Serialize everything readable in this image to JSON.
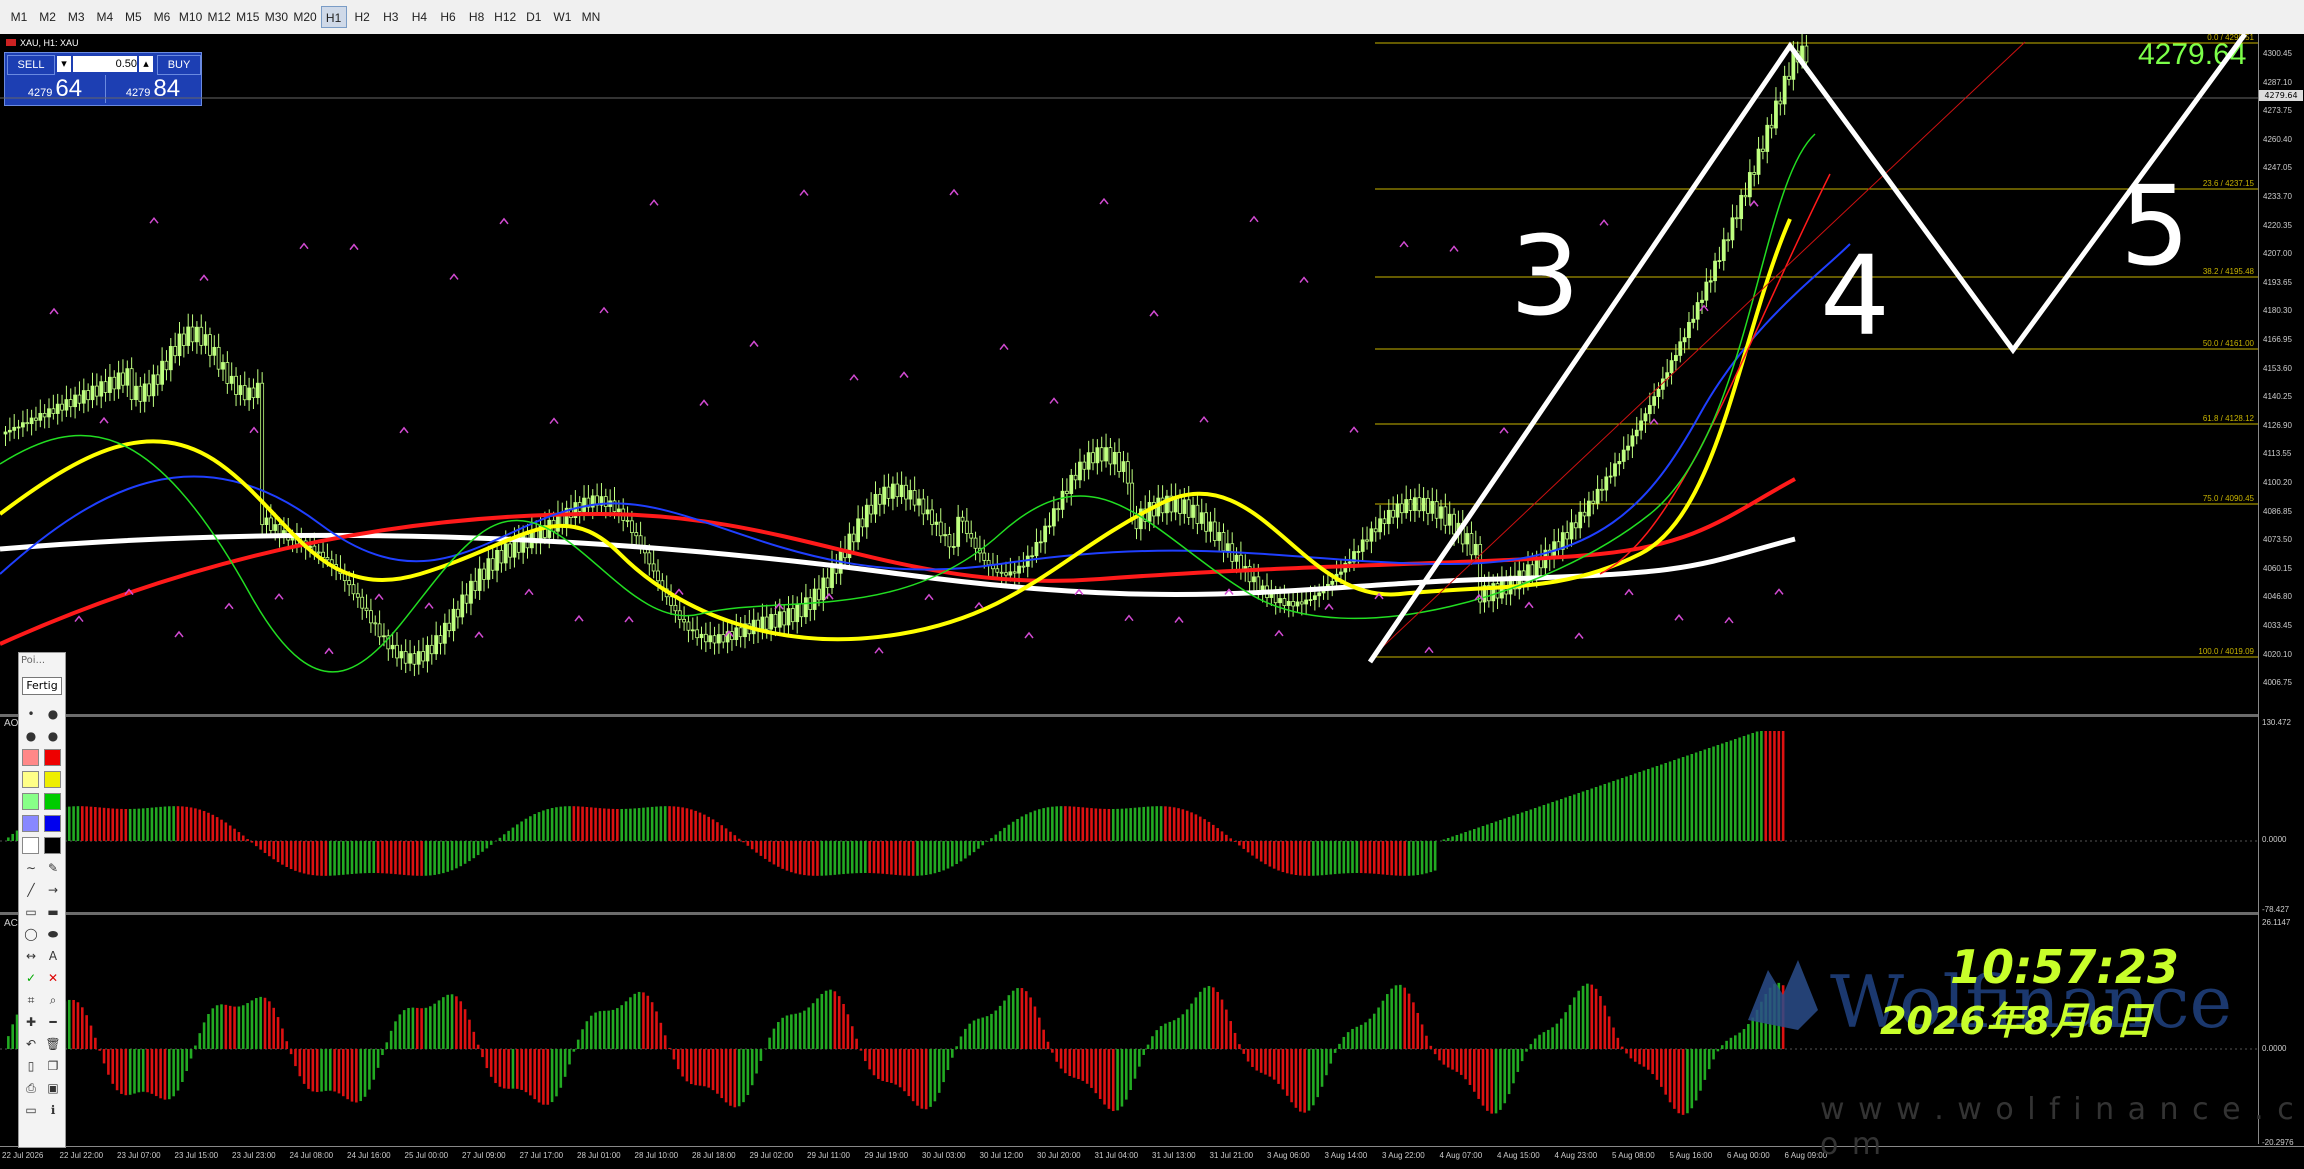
{
  "timeframes": [
    "M1",
    "M2",
    "M3",
    "M4",
    "M5",
    "M6",
    "M10",
    "M12",
    "M15",
    "M30",
    "M20",
    "H1",
    "H2",
    "H3",
    "H4",
    "H6",
    "H8",
    "H12",
    "D1",
    "W1",
    "MN"
  ],
  "active_timeframe": "H1",
  "chart": {
    "title": "XAU, H1: XAU",
    "symbol": "XAU",
    "price_label": "4279.64",
    "current_tag": "4279.64"
  },
  "trade_panel": {
    "sell_label": "SELL",
    "buy_label": "BUY",
    "lot": "0.50",
    "sell_prefix": "4279",
    "sell_big": "64",
    "buy_prefix": "4279",
    "buy_big": "84"
  },
  "price_axis": [
    "4300.45",
    "4287.10",
    "4273.75",
    "4260.40",
    "4247.05",
    "4233.70",
    "4220.35",
    "4207.00",
    "4193.65",
    "4180.30",
    "4166.95",
    "4153.60",
    "4140.25",
    "4126.90",
    "4113.55",
    "4100.20",
    "4086.85",
    "4073.50",
    "4060.15",
    "4046.80",
    "4033.45",
    "4020.10",
    "4006.75"
  ],
  "fib_levels": [
    {
      "label": "0.0  /   4299.51"
    },
    {
      "label": "23.6  /   4237.15"
    },
    {
      "label": "38.2  /   4195.48"
    },
    {
      "label": "50.0  /   4161.00"
    },
    {
      "label": "61.8  /   4128.12"
    },
    {
      "label": "75.0  /   4090.45"
    },
    {
      "label": "100.0  /   4019.09"
    }
  ],
  "wave_labels": [
    "3",
    "4",
    "5"
  ],
  "ao": {
    "label": "AO",
    "max": "130.472",
    "zero": "0.0000",
    "min": "-78.427"
  },
  "ac": {
    "label": "AC",
    "max": "26.1147",
    "zero": "0.0000",
    "min": "-20.2976"
  },
  "time_axis": [
    "22 Jul 2026",
    "22 Jul 22:00",
    "23 Jul 07:00",
    "23 Jul 15:00",
    "23 Jul 23:00",
    "24 Jul 08:00",
    "24 Jul 16:00",
    "25 Jul 00:00",
    "27 Jul 09:00",
    "27 Jul 17:00",
    "28 Jul 01:00",
    "28 Jul 10:00",
    "28 Jul 18:00",
    "29 Jul 02:00",
    "29 Jul 11:00",
    "29 Jul 19:00",
    "30 Jul 03:00",
    "30 Jul 12:00",
    "30 Jul 20:00",
    "31 Jul 04:00",
    "31 Jul 13:00",
    "31 Jul 21:00",
    "3 Aug 06:00",
    "3 Aug 14:00",
    "3 Aug 22:00",
    "4 Aug 07:00",
    "4 Aug 15:00",
    "4 Aug 23:00",
    "5 Aug 08:00",
    "5 Aug 16:00",
    "6 Aug 00:00",
    "6 Aug 09:00"
  ],
  "overlay": {
    "clock": "10:57:23",
    "date": "2026年8月6日",
    "watermark": "Wolfinance",
    "website": "w w w . w o l f i n a n c e . c o m"
  },
  "tool_panel": {
    "title": "Poi...",
    "done_label": "Fertig"
  },
  "colors": {
    "bull": "#22aa22",
    "bear": "#dd1111",
    "fib": "#c8b400",
    "ma_white": "#ffffff",
    "ma_yellow": "#ffff00",
    "ma_red": "#ff1a1a",
    "ma_blue": "#1f3fff",
    "ma_green": "#22dd22"
  }
}
